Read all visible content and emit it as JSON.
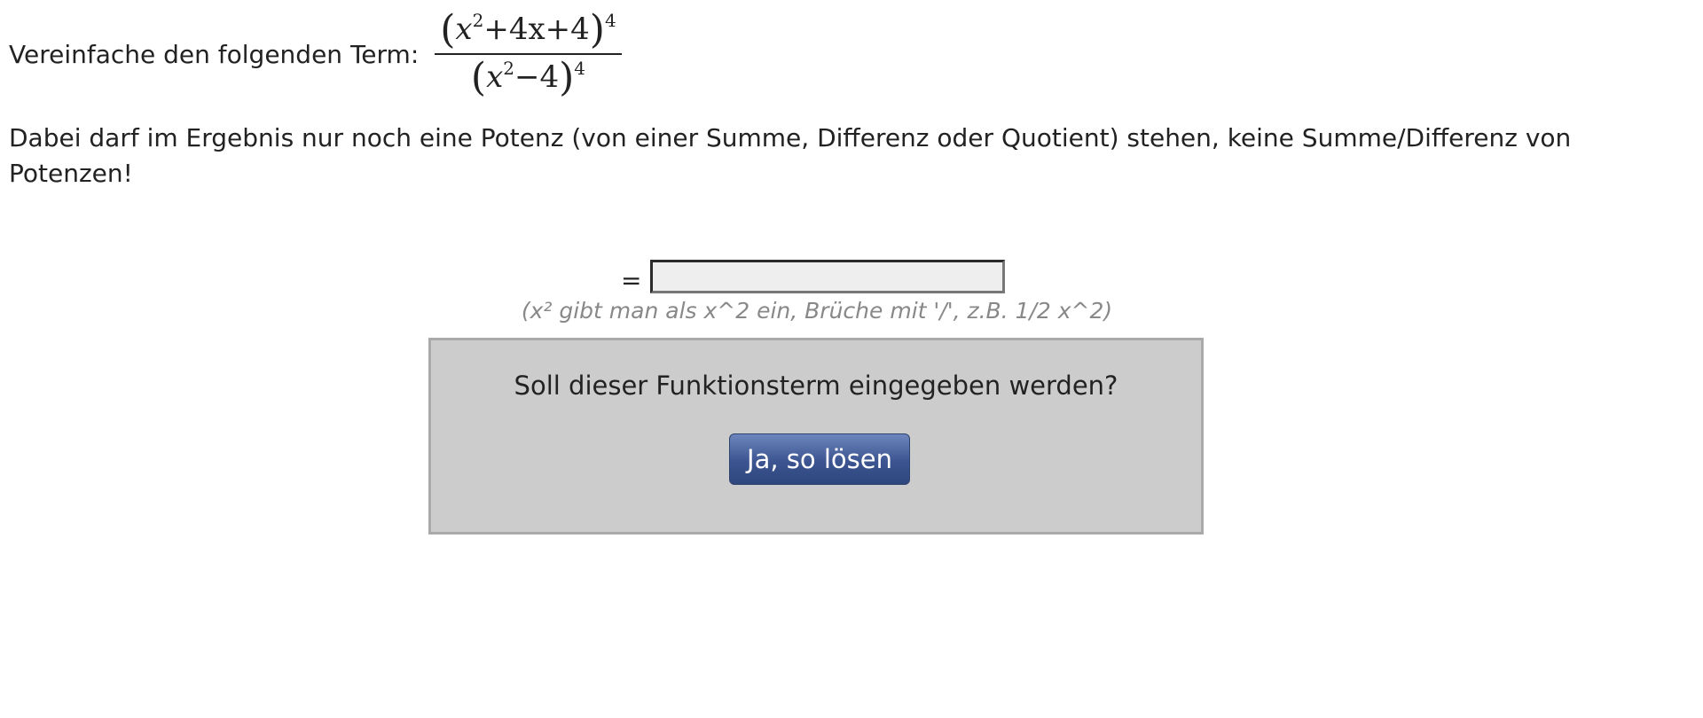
{
  "task": {
    "label": "Vereinfache den folgenden Term:",
    "fraction": {
      "numerator": {
        "base_x": "x",
        "base_exp": "2",
        "rest": "+4x+4",
        "outer_exp": "4"
      },
      "denominator": {
        "base_x": "x",
        "base_exp": "2",
        "rest": "−4",
        "outer_exp": "4"
      }
    }
  },
  "instruction": "Dabei darf im Ergebnis nur noch eine Potenz (von einer Summe, Differenz oder Quotient) stehen, keine Summe/Differenz von Potenzen!",
  "answer": {
    "equals": "=",
    "value": "",
    "placeholder": ""
  },
  "hint": "(x² gibt man als x^2 ein, Brüche mit '/', z.B. 1/2 x^2)",
  "confirm": {
    "question": "Soll dieser Funktionsterm eingegeben werden?",
    "button_label": "Ja, so lösen"
  }
}
